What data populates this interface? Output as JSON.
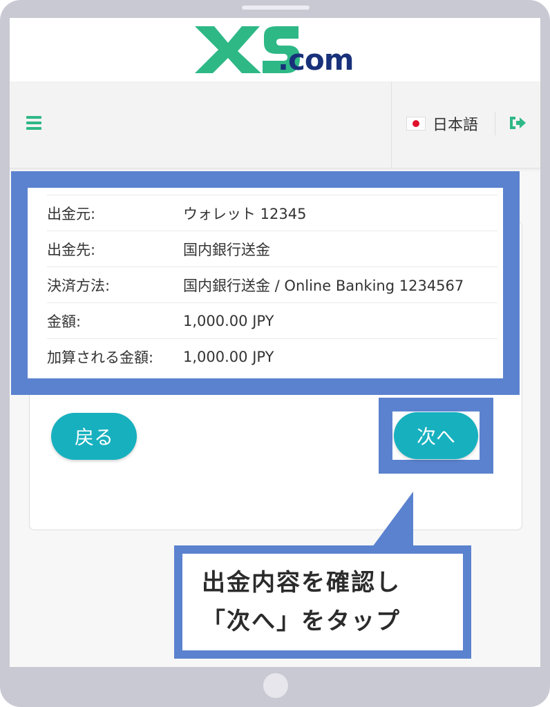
{
  "header": {
    "logo_text": ".com",
    "logo_accent": "#2eb886",
    "logo_dark": "#18317a",
    "language": "日本語",
    "menu_icon": "hamburger-menu-icon",
    "logout_icon": "logout-icon",
    "flag_icon": "japan-flag-icon"
  },
  "details": {
    "rows": [
      {
        "label": "出金元:",
        "value": "ウォレット 12345"
      },
      {
        "label": "出金先:",
        "value": "国内銀行送金"
      },
      {
        "label": "決済方法:",
        "value": "国内銀行送金 / Online Banking 1234567"
      },
      {
        "label": "金額:",
        "value": "1,000.00 JPY"
      },
      {
        "label": "加算される金額:",
        "value": "1,000.00 JPY"
      }
    ]
  },
  "actions": {
    "back_label": "戻る",
    "next_label": "次へ",
    "button_color": "#17b0bf"
  },
  "callout": {
    "line1": "出金内容を確認し",
    "line2": "「次へ」をタップ",
    "highlight_color": "#5b82cf"
  }
}
